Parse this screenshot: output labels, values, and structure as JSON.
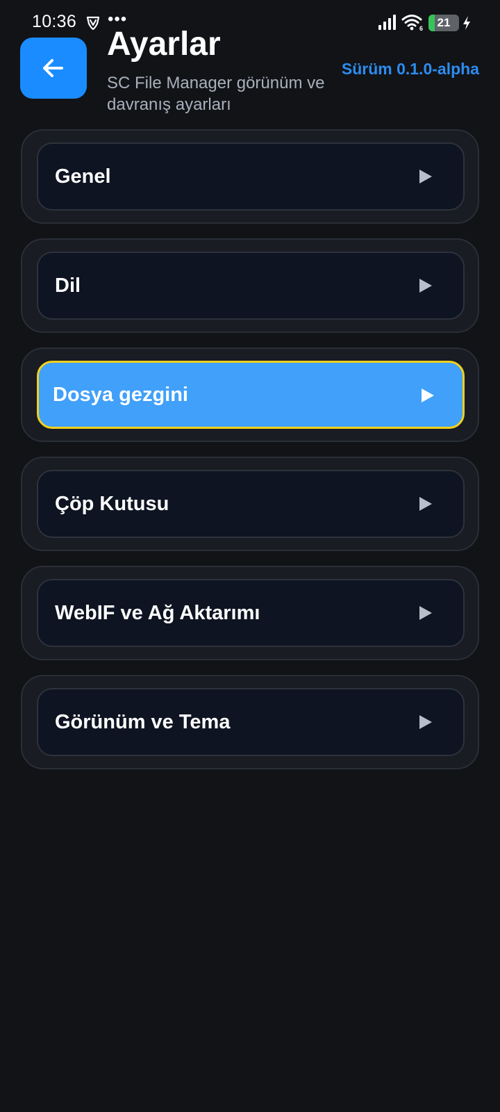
{
  "status_bar": {
    "time": "10:36",
    "more_indicator": "•••",
    "vpn_icon": "shield-v-icon",
    "signal_icon": "cellular-signal-icon",
    "wifi_icon": "wifi-icon",
    "wifi_badge": "6",
    "battery_level": "21",
    "battery_fraction": 0.21,
    "charging_icon": "bolt-icon"
  },
  "header": {
    "back_icon": "arrow-left-icon",
    "title": "Ayarlar",
    "subtitle": "SC File Manager görünüm ve davranış ayarları",
    "version": "Sürüm 0.1.0-alpha"
  },
  "settings": {
    "items": [
      {
        "label": "Genel"
      },
      {
        "label": "Dil"
      },
      {
        "label": "Dosya gezgini",
        "selected": true
      },
      {
        "label": "Çöp Kutusu"
      },
      {
        "label": "WebIF ve Ağ Aktarımı"
      },
      {
        "label": "Görünüm ve Tema"
      }
    ],
    "arrow_icon": "play-arrow-icon"
  },
  "colors": {
    "background": "#111317",
    "accent": "#1a8cff",
    "selected_item": "#40a0fa",
    "selected_outline": "#f2d01d",
    "version_text": "#2d8cf0",
    "battery_fill": "#36c45a"
  }
}
